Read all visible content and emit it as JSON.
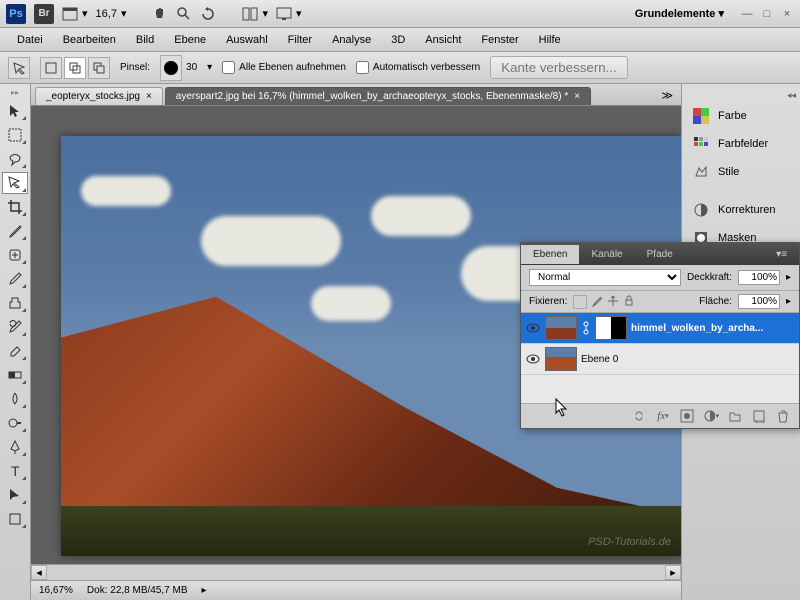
{
  "app": {
    "workspace": "Grundelemente",
    "zoom_display": "16,7"
  },
  "menu": {
    "file": "Datei",
    "edit": "Bearbeiten",
    "image": "Bild",
    "layer": "Ebene",
    "select": "Auswahl",
    "filter": "Filter",
    "analysis": "Analyse",
    "3d": "3D",
    "view": "Ansicht",
    "window": "Fenster",
    "help": "Hilfe"
  },
  "options": {
    "brush_label": "Pinsel:",
    "brush_size": "30",
    "sample_all_layers": "Alle Ebenen aufnehmen",
    "auto_enhance": "Automatisch verbessern",
    "refine_edge": "Kante verbessern..."
  },
  "tabs": [
    {
      "title": "_eopteryx_stocks.jpg",
      "active": false
    },
    {
      "title": "ayerspart2.jpg bei 16,7% (himmel_wolken_by_archaeopteryx_stocks, Ebenenmaske/8) *",
      "active": true
    }
  ],
  "status": {
    "zoom": "16,67%",
    "doc_size": "Dok: 22,8 MB/45,7 MB"
  },
  "panels": {
    "color": "Farbe",
    "swatches": "Farbfelder",
    "styles": "Stile",
    "adjustments": "Korrekturen",
    "masks": "Masken"
  },
  "layers_panel": {
    "tabs": {
      "layers": "Ebenen",
      "channels": "Kanäle",
      "paths": "Pfade"
    },
    "blend_mode": "Normal",
    "opacity_label": "Deckkraft:",
    "opacity_value": "100%",
    "lock_label": "Fixieren:",
    "fill_label": "Fläche:",
    "fill_value": "100%",
    "layers": [
      {
        "name": "himmel_wolken_by_archa...",
        "selected": true,
        "has_mask": true
      },
      {
        "name": "Ebene 0",
        "selected": false,
        "has_mask": false
      }
    ]
  },
  "watermark": "PSD-Tutorials.de"
}
